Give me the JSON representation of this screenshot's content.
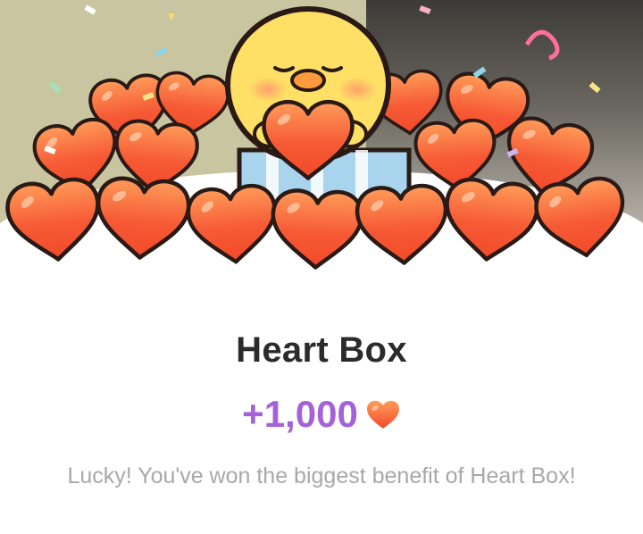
{
  "dialog": {
    "title": "Heart Box",
    "reward_amount": "+1,000",
    "reward_icon": "heart-icon",
    "message": "Lucky! You've won the biggest benefit of Heart Box!"
  },
  "colors": {
    "title": "#2b2b2b",
    "reward": "#a462d8",
    "message": "#a8a8a8",
    "heart": "#f2552f",
    "heart_light": "#ffa25e",
    "mascot": "#ffe066"
  }
}
